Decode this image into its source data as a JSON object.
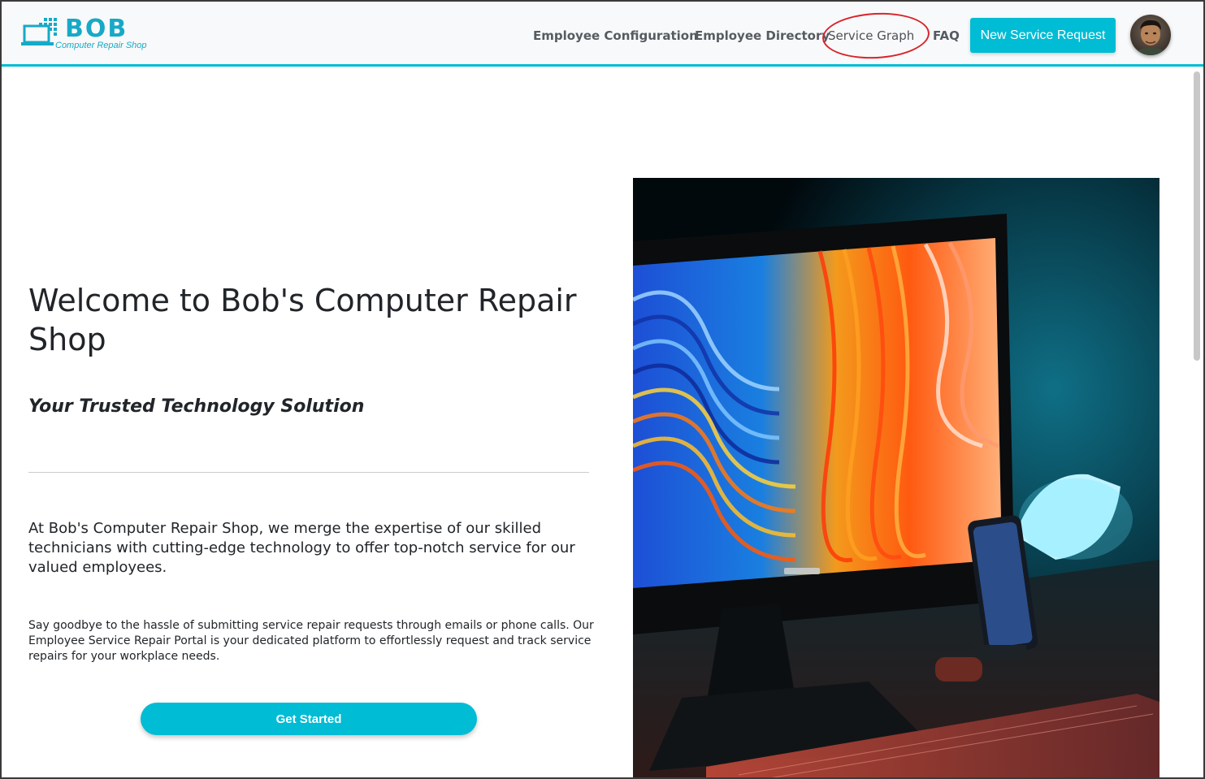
{
  "brand": {
    "name": "BOB",
    "tagline": "Computer Repair Shop",
    "accent": "#00bcd4"
  },
  "nav": {
    "links": [
      {
        "label": "Employee Configuration"
      },
      {
        "label": "Employee Directory"
      },
      {
        "label": "Service Graph"
      },
      {
        "label": "FAQ"
      }
    ],
    "cta_label": "New Service Request",
    "avatar_icon": "user-avatar-photo"
  },
  "hero": {
    "title": "Welcome to Bob's Computer Repair Shop",
    "subtitle": "Your Trusted Technology Solution",
    "lead": "At Bob's Computer Repair Shop, we merge the expertise of our skilled technicians with cutting-edge technology to offer top-notch service for our valued employees.",
    "body": "Say goodbye to the hassle of submitting service repair requests through emails or phone calls. Our Employee Service Repair Portal is your dedicated platform to effortlessly request and track service repairs for your workplace needs.",
    "button_label": "Get Started",
    "image_icon": "desk-setup-photo"
  },
  "annotation": {
    "color": "#d9242b",
    "target": "Service Graph"
  }
}
